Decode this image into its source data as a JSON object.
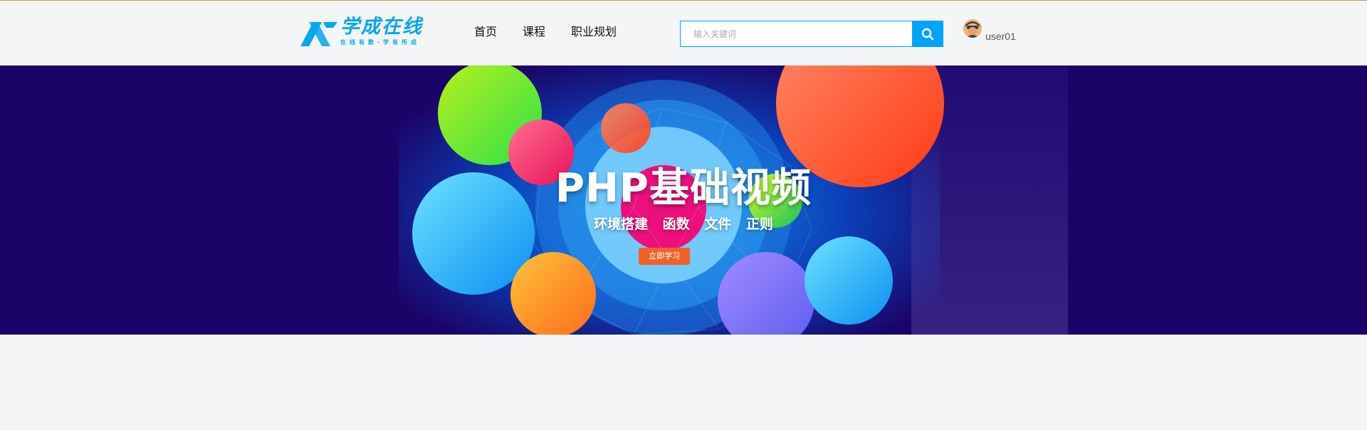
{
  "header": {
    "logo": {
      "brand": "学成在线",
      "slogan": "在线有数·学有所成"
    },
    "nav": [
      {
        "label": "首页"
      },
      {
        "label": "课程"
      },
      {
        "label": "职业规划"
      }
    ],
    "search": {
      "placeholder": "输入关键词",
      "value": ""
    },
    "user": {
      "name": "user01"
    }
  },
  "banner": {
    "title": "PHP基础视频",
    "subtitle": "环境搭建  函数 文件 正则",
    "cta_label": "立即学习"
  },
  "colors": {
    "accent": "#00a4ff",
    "banner_bg": "#1b0467",
    "cta": "#f0622a",
    "top_line": "#c8a236"
  },
  "icons": {
    "search_button": "search-icon",
    "avatar": "user-avatar"
  }
}
